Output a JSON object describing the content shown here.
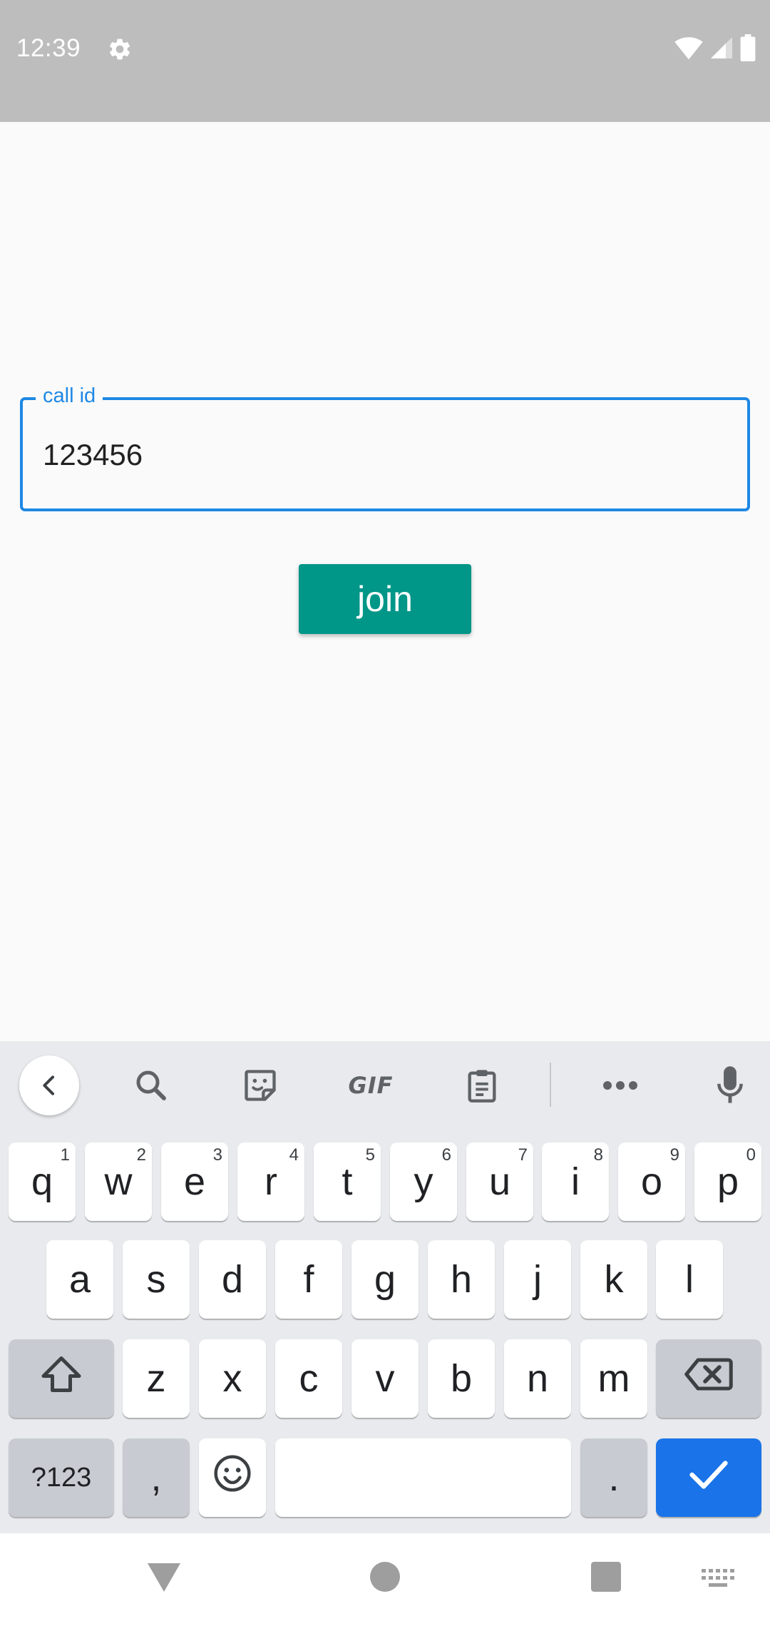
{
  "status_bar": {
    "time": "12:39",
    "icons": [
      "gear-icon",
      "wifi-icon",
      "signal-icon",
      "battery-icon"
    ],
    "background": "#bdbdbd"
  },
  "form": {
    "field_label": "call id",
    "field_value": "123456",
    "accent_color": "#1e88e5",
    "join_label": "join",
    "join_color": "#009688"
  },
  "keyboard": {
    "toolbar_icons": [
      "back-icon",
      "search-icon",
      "sticker-icon",
      "gif-icon",
      "clipboard-icon",
      "more-icon",
      "mic-icon"
    ],
    "gif_label": "GIF",
    "row1": [
      {
        "key": "q",
        "hint": "1"
      },
      {
        "key": "w",
        "hint": "2"
      },
      {
        "key": "e",
        "hint": "3"
      },
      {
        "key": "r",
        "hint": "4"
      },
      {
        "key": "t",
        "hint": "5"
      },
      {
        "key": "y",
        "hint": "6"
      },
      {
        "key": "u",
        "hint": "7"
      },
      {
        "key": "i",
        "hint": "8"
      },
      {
        "key": "o",
        "hint": "9"
      },
      {
        "key": "p",
        "hint": "0"
      }
    ],
    "row2": [
      "a",
      "s",
      "d",
      "f",
      "g",
      "h",
      "j",
      "k",
      "l"
    ],
    "row3": [
      "z",
      "x",
      "c",
      "v",
      "b",
      "n",
      "m"
    ],
    "symbols_label": "?123",
    "comma_label": ",",
    "period_label": ".",
    "action_color": "#1a73e8"
  },
  "nav_bar": {
    "icons": [
      "back-triangle-icon",
      "home-circle-icon",
      "recents-square-icon",
      "keyboard-switch-icon"
    ]
  }
}
